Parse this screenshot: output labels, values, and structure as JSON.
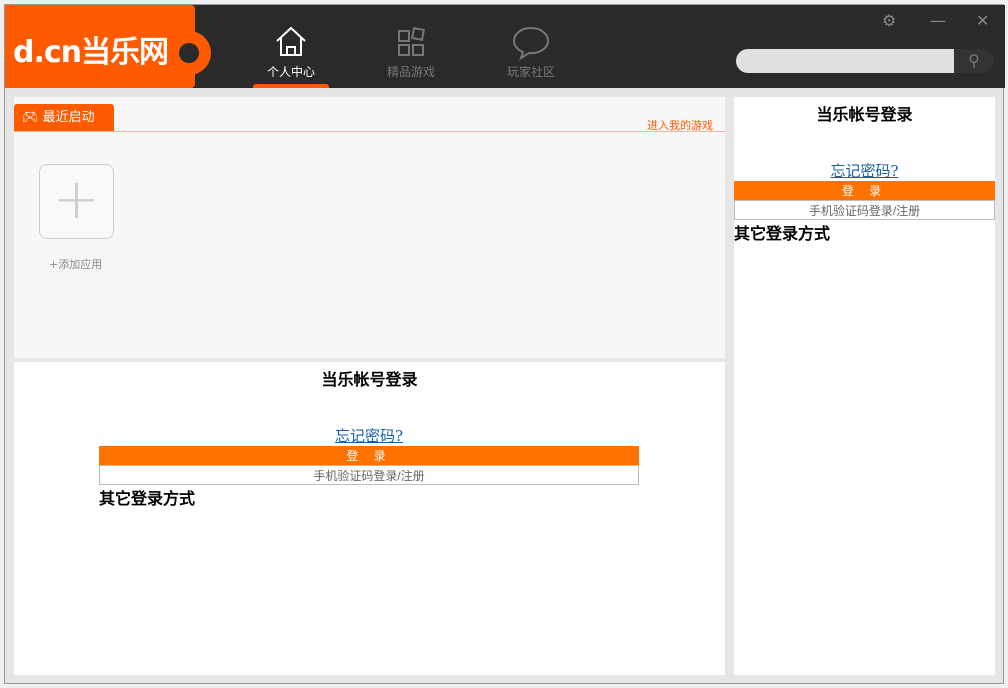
{
  "logo": "d.cn当乐网",
  "nav": [
    {
      "label": "个人中心"
    },
    {
      "label": "精品游戏"
    },
    {
      "label": "玩家社区"
    }
  ],
  "search": {
    "placeholder": ""
  },
  "recent": {
    "tab": "最近启动",
    "enter": "进入我的游戏",
    "add_label": "+添加应用"
  },
  "login": {
    "title": "当乐帐号登录",
    "forgot": "忘记密码?",
    "login_btn": "登 录",
    "phone_btn": "手机验证码登录/注册",
    "other": "其它登录方式"
  },
  "colors": {
    "brand": "#ff5a00",
    "header": "#2a2a2b"
  }
}
